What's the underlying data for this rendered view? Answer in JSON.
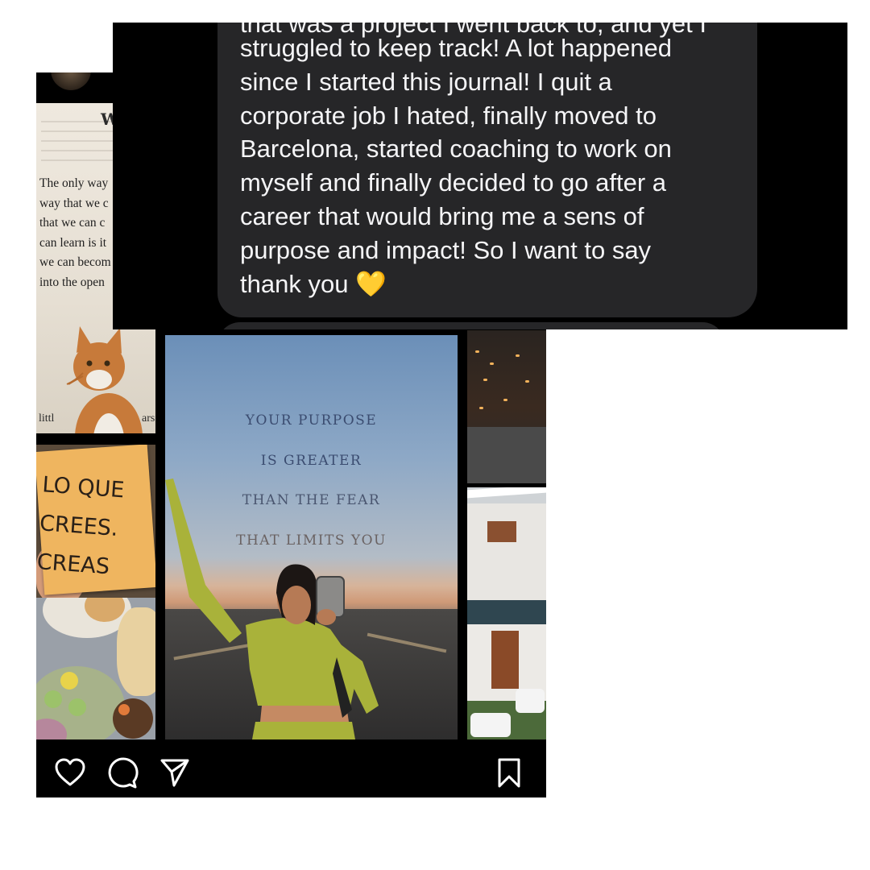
{
  "message": {
    "partial_first_line": "that was a project I went back to, and yet I",
    "body": "struggled to keep track! A lot happened\nsince I started this journal! I quit a\ncorporate job I hated, finally moved to\nBarcelona, started coaching to work on\nmyself and finally decided to go after a\ncareer that would bring me a sens of\npurpose and impact! So I want to say\nthank you 💛"
  },
  "post": {
    "book_heading": "W",
    "book_lines": "The only way\nway that we c\nthat we can c\ncan learn is it\nwe can becom\ninto the open",
    "book_bottom": "littl",
    "book_bottom_right": "ars",
    "sticky_note": "LO QUE\nCREES.\nCREAS",
    "quote": [
      "YOUR PURPOSE",
      "IS GREATER",
      "THAN THE FEAR",
      "THAT LIMITS YOU"
    ]
  },
  "actions": {
    "like_icon": "heart-icon",
    "comment_icon": "comment-icon",
    "share_icon": "send-icon",
    "save_icon": "bookmark-icon"
  },
  "colors": {
    "bubble": "#262628",
    "quote_text": "#3b4c70",
    "sticky": "#efb55f",
    "outfit": "#a9b23a"
  }
}
